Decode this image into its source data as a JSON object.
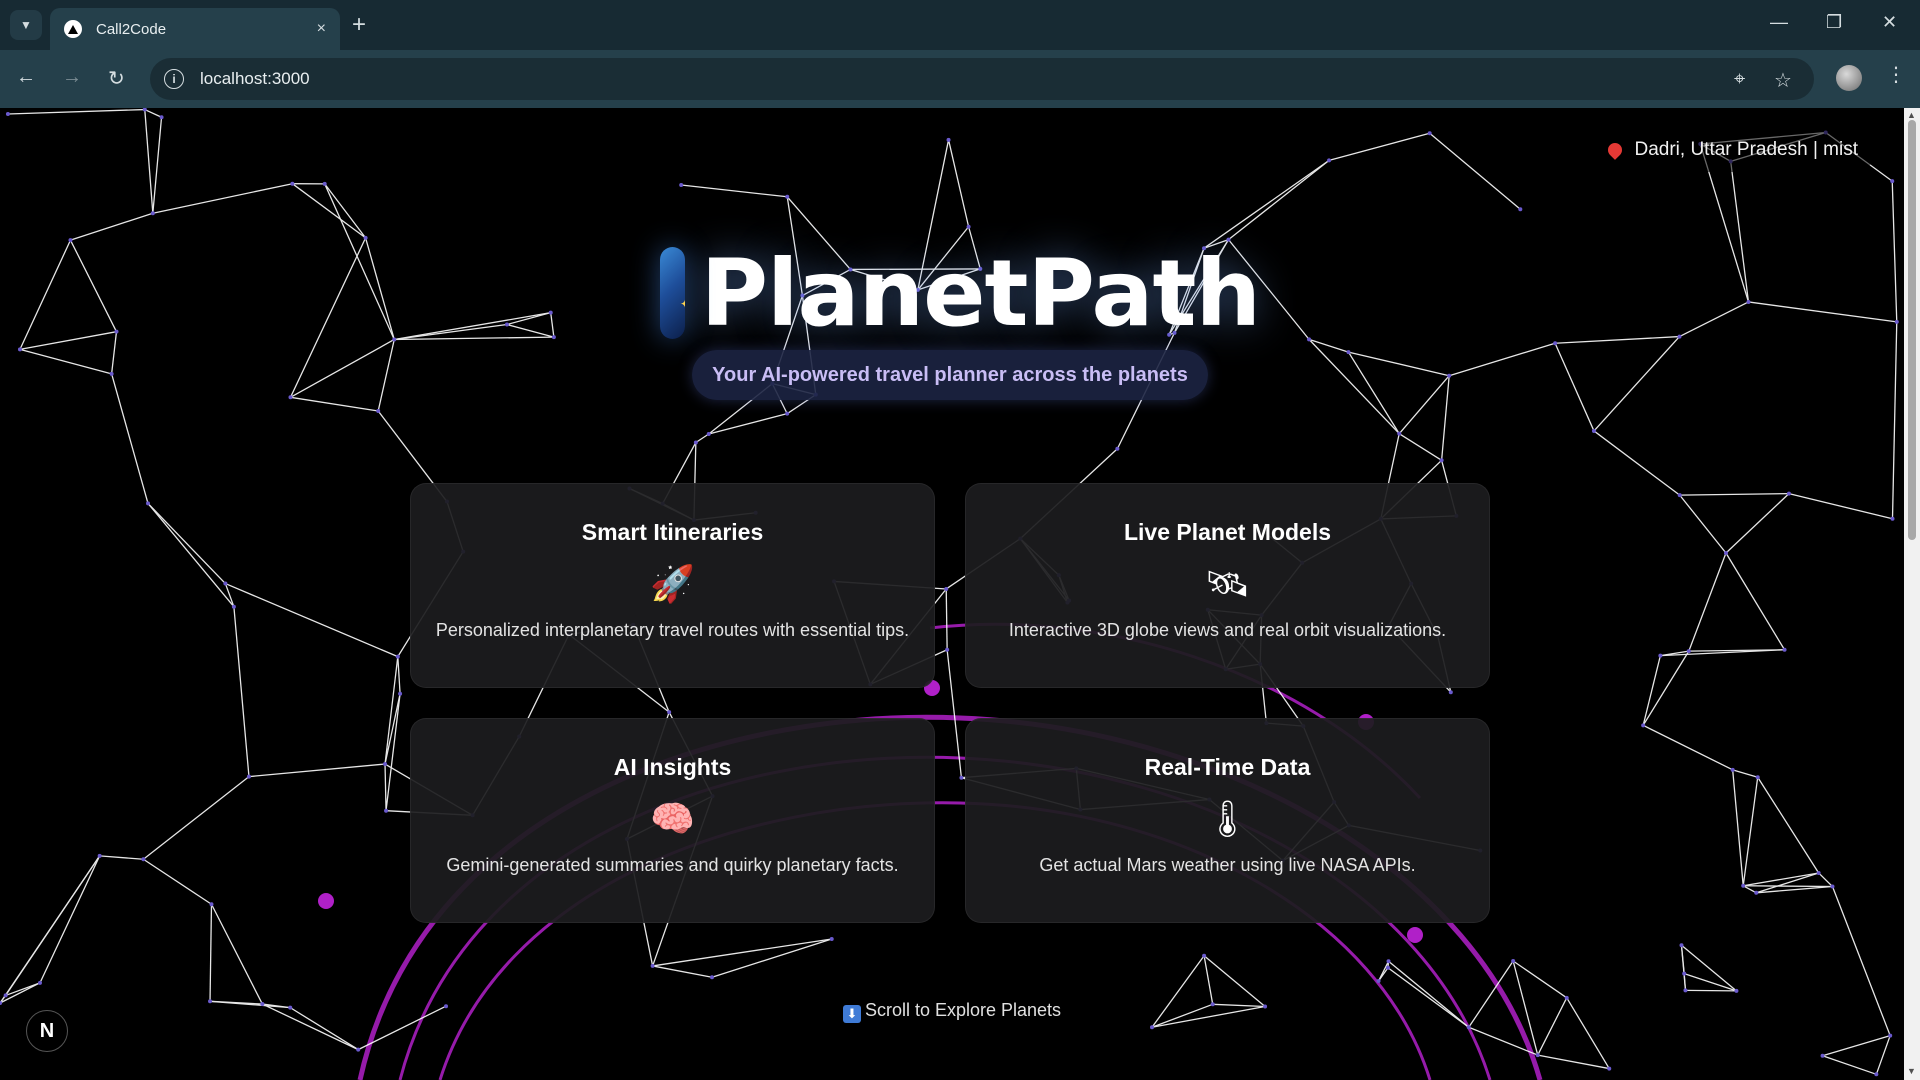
{
  "browser": {
    "tab_title": "Call2Code",
    "url": "localhost:3000",
    "new_tab_label": "+",
    "tab_close_label": "×"
  },
  "page": {
    "location": "Dadri, Uttar Pradesh | mist",
    "app_title": "PlanetPath",
    "tagline": "Your AI-powered travel planner across the planets",
    "features": [
      {
        "title": "Smart Itineraries",
        "icon": "rocket-icon",
        "glyph": "🚀",
        "description": "Personalized interplanetary travel routes with essential tips."
      },
      {
        "title": "Live Planet Models",
        "icon": "satellite-icon",
        "glyph": "🛰",
        "description": "Interactive 3D globe views and real orbit visualizations."
      },
      {
        "title": "AI Insights",
        "icon": "brain-icon",
        "glyph": "🧠",
        "description": "Gemini-generated summaries and quirky planetary facts."
      },
      {
        "title": "Real-Time Data",
        "icon": "thermometer-icon",
        "glyph": "🌡",
        "description": "Get actual Mars weather using live NASA APIs."
      }
    ],
    "scroll_hint": "Scroll to Explore Planets",
    "scroll_hint_icon": "⬇",
    "dev_badge": "N"
  },
  "colors": {
    "background": "#000000",
    "network_lines": "#ffffff",
    "orbit_accent": "#b020c8",
    "tagline_text": "#c9bdf5",
    "chrome_dark": "#172a33",
    "chrome_toolbar": "#25404b"
  }
}
